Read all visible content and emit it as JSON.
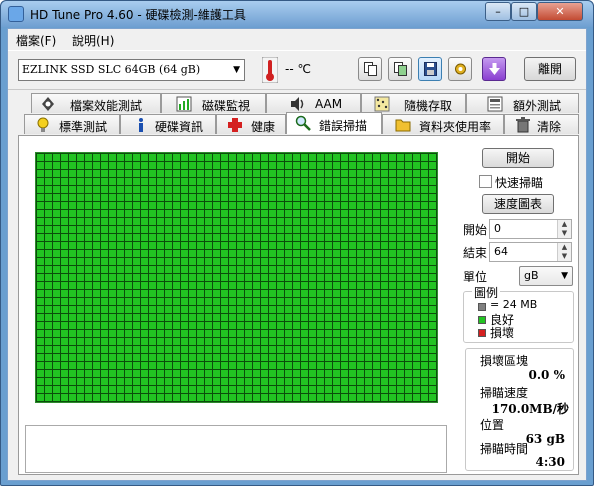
{
  "window": {
    "title": "HD Tune Pro 4.60 - 硬碟檢測-維護工具",
    "controls": {
      "minimize": "–",
      "maximize": "□",
      "close": "✕"
    }
  },
  "menu": {
    "file": "檔案(F)",
    "help": "說明(H)"
  },
  "toolbar": {
    "drive": "EZLINK  SSD SLC 64GB      (64 gB)",
    "temperature": "-- ℃",
    "exit_label": "離開"
  },
  "tabs_top": [
    {
      "label": "檔案效能測試",
      "icon": "file-benchmark-icon"
    },
    {
      "label": "磁碟監視",
      "icon": "disk-monitor-icon"
    },
    {
      "label": "AAM",
      "icon": "speaker-icon"
    },
    {
      "label": "隨機存取",
      "icon": "random-access-icon"
    },
    {
      "label": "額外測試",
      "icon": "extra-tests-icon"
    }
  ],
  "tabs_bottom": [
    {
      "label": "標準測試",
      "icon": "lightbulb-icon"
    },
    {
      "label": "硬碟資訊",
      "icon": "info-icon"
    },
    {
      "label": "健康",
      "icon": "health-cross-icon"
    },
    {
      "label": "錯誤掃描",
      "icon": "magnifier-icon",
      "active": true
    },
    {
      "label": "資料夾使用率",
      "icon": "folder-icon"
    },
    {
      "label": "清除",
      "icon": "trash-icon"
    }
  ],
  "scan": {
    "start_button": "開始",
    "quick_scan_label": "快速掃瞄",
    "quick_scan_checked": false,
    "speed_map_button": "速度圖表",
    "start_label": "開始",
    "start_value": "0",
    "end_label": "結束",
    "end_value": "64",
    "unit_label": "單位",
    "unit_value": "gB",
    "legend_title": "圖例",
    "legend": [
      {
        "label": "= 24 MB",
        "color": "#808080"
      },
      {
        "label": "良好",
        "color": "#22c422"
      },
      {
        "label": "損壞",
        "color": "#d42020"
      }
    ],
    "stats": {
      "damaged_label": "損壞區塊",
      "damaged_value": "0.0 %",
      "speed_label": "掃瞄速度",
      "speed_value": "170.0MB/秒",
      "position_label": "位置",
      "position_value": "63 gB",
      "time_label": "掃瞄時間",
      "time_value": "4:30"
    },
    "block_map": {
      "good_percent": 100,
      "damaged_percent": 0.0
    }
  },
  "colors": {
    "good": "#22c422",
    "damaged": "#d42020",
    "titlebar": "#8ab6e2"
  }
}
